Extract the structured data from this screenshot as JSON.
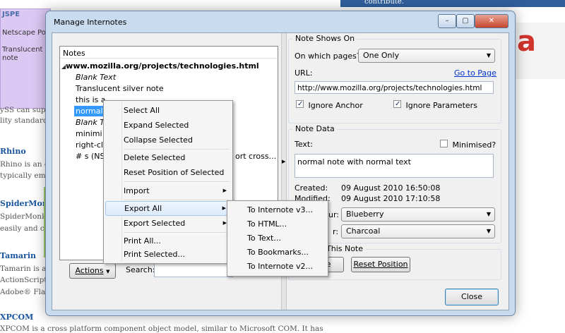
{
  "background": {
    "top_right_text": "contribute.",
    "sticky_title": "JSPE",
    "sticky_lines": [
      "Netscape Po",
      "",
      "Translucent s",
      "note"
    ],
    "side_texts": [
      "ySS can sup",
      "lity standard"
    ],
    "sections": [
      {
        "title": "Rhino",
        "lines": [
          "Rhino is an o",
          "typically em"
        ]
      },
      {
        "title": "SpiderMon",
        "lines": [
          "SpiderMonk",
          "easily and ca"
        ]
      },
      {
        "title": "Tamarin",
        "lines": [
          "Tamarin is a",
          "ActionScript",
          "Adobe® Flas"
        ]
      },
      {
        "title": "XPCOM",
        "lines": [
          "XPCOM is a cross platform component object model, similar to Microsoft COM. It has"
        ]
      }
    ],
    "red_letter": "a"
  },
  "window": {
    "title": "Manage Internotes",
    "controls": {
      "minimize": "–",
      "maximize": "▢",
      "close": "✕"
    }
  },
  "notes": {
    "label": "Notes",
    "root": "www.mozilla.org/projects/technologies.html",
    "items": [
      {
        "text": "Blank Text",
        "italic": true,
        "selected": false
      },
      {
        "text": "Translucent silver note",
        "italic": false,
        "selected": false
      },
      {
        "text": "this is a",
        "italic": false,
        "selected": false
      },
      {
        "text": "normal",
        "italic": false,
        "selected": true
      },
      {
        "text": "Blank T",
        "italic": true,
        "selected": false
      },
      {
        "text": "minimi",
        "italic": false,
        "selected": false
      },
      {
        "text": "right-cl",
        "italic": false,
        "selected": false
      },
      {
        "text": "# s (NS",
        "italic": false,
        "selected": false
      }
    ],
    "overflow_text": "ort cross..."
  },
  "bottom_bar": {
    "actions_label": "Actions",
    "search_label": "Search:",
    "search_value": ""
  },
  "context_menu": {
    "items": [
      "Select All",
      "Expand Selected",
      "Collapse Selected",
      "Delete Selected",
      "Reset Position of Selected",
      "Import",
      "Export All",
      "Export Selected",
      "Print All...",
      "Print Selected..."
    ]
  },
  "export_submenu": {
    "items": [
      "To Internote v3...",
      "To HTML...",
      "To Text...",
      "To Bookmarks...",
      "To Internote v2..."
    ]
  },
  "note_shows_on": {
    "group_label": "Note Shows On",
    "pages_label": "On which pages?",
    "pages_value": "One Only",
    "url_label": "URL:",
    "goto_label": "Go to Page",
    "url_value": "http://www.mozilla.org/projects/technologies.html",
    "ignore_anchor": "Ignore Anchor",
    "ignore_anchor_checked": true,
    "ignore_params": "Ignore Parameters",
    "ignore_params_checked": true
  },
  "note_data": {
    "group_label": "Note Data",
    "text_label": "Text:",
    "minimised_label": "Minimised?",
    "minimised_checked": false,
    "text_value": "normal note with normal text",
    "created_label": "Created:",
    "created_value": "09 August 2010 16:50:08",
    "modified_label": "Modified:",
    "modified_value": "09 August 2010 17:10:58",
    "color1_label_partial": "ur:",
    "color1_value": "Blueberry",
    "color2_label_partial": "r:",
    "color2_value": "Charcoal"
  },
  "this_note": {
    "group_label_partial": "This Note",
    "button1_partial": "te",
    "reset_label": "Reset Position"
  },
  "close_label": "Close",
  "colors": {
    "selection": "#3399ff",
    "window_frame": "#c9dbee",
    "link": "#0033cc",
    "bg_link": "#1a55a0"
  }
}
